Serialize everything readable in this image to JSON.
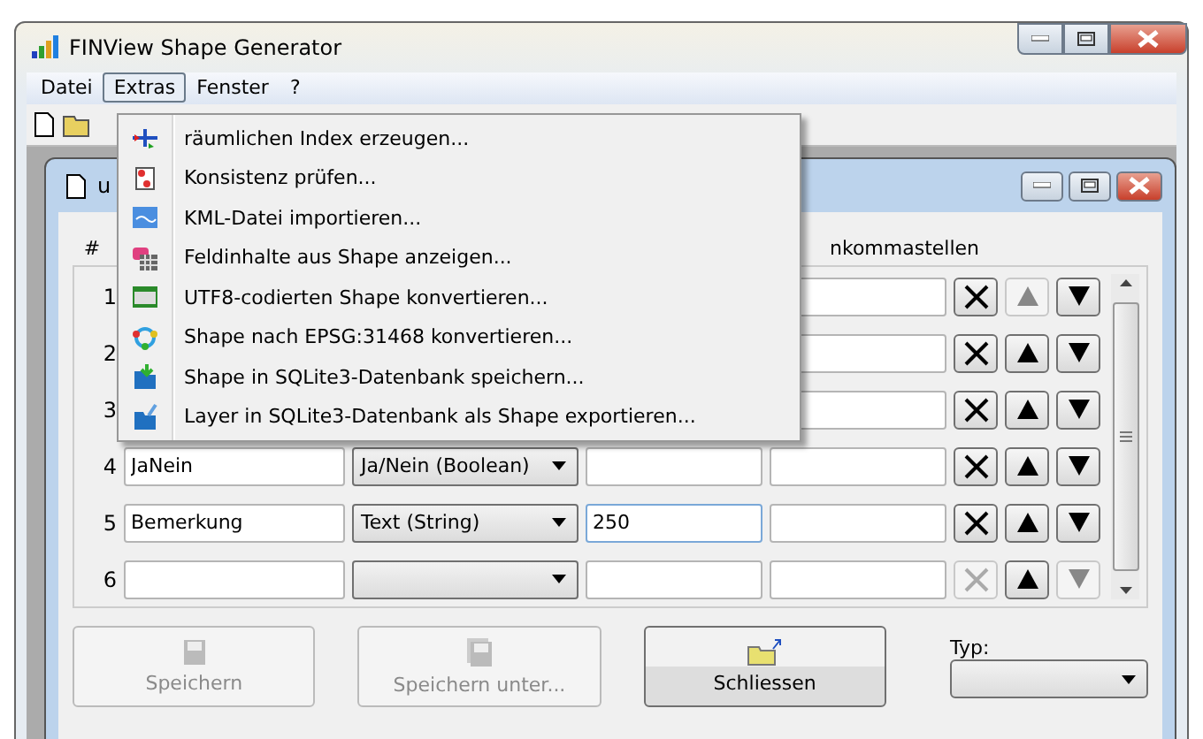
{
  "window": {
    "title": "FINView Shape Generator"
  },
  "menu_bar": [
    {
      "label": "Datei",
      "selected": false
    },
    {
      "label": "Extras",
      "selected": true
    },
    {
      "label": "Fenster",
      "selected": false
    },
    {
      "label": "?",
      "selected": false
    }
  ],
  "extras_menu": [
    "räumlichen Index erzeugen...",
    "Konsistenz prüfen...",
    "KML-Datei importieren...",
    "Feldinhalte aus Shape anzeigen...",
    "UTF8-codierten Shape konvertieren...",
    "Shape nach EPSG:31468 konvertieren...",
    "Shape in SQLite3-Datenbank speichern...",
    "Layer in SQLite3-Datenbank als Shape exportieren..."
  ],
  "child_window": {
    "title": "u"
  },
  "table": {
    "columns": [
      "#",
      "nkommastellen"
    ],
    "rows": [
      {
        "number": "1",
        "kind": "covered",
        "can_delete": true,
        "can_move_up": false,
        "can_move_down": true
      },
      {
        "number": "2",
        "kind": "covered",
        "can_delete": true,
        "can_move_up": true,
        "can_move_down": true
      },
      {
        "number": "3",
        "kind": "covered",
        "can_delete": true,
        "can_move_up": true,
        "can_move_down": true
      },
      {
        "number": "4",
        "kind": "field",
        "name": "JaNein",
        "type": "Ja/Nein (Boolean)",
        "focused": false,
        "can_delete": true,
        "can_move_up": true,
        "can_move_down": true
      },
      {
        "number": "5",
        "kind": "field",
        "name": "Bemerkung",
        "type": "Text (String)",
        "length": "250",
        "focused": true,
        "can_delete": true,
        "can_move_up": true,
        "can_move_down": true
      },
      {
        "number": "6",
        "kind": "field",
        "focused": false,
        "can_delete": false,
        "can_move_up": true,
        "can_move_down": false
      }
    ]
  },
  "buttons": [
    {
      "label": "Speichern",
      "kind": "save",
      "disabled": true
    },
    {
      "label": "Speichern unter...",
      "kind": "save-as",
      "disabled": true
    },
    {
      "label": "Schliessen",
      "kind": "close",
      "disabled": false
    }
  ],
  "type_label": "Typ:"
}
